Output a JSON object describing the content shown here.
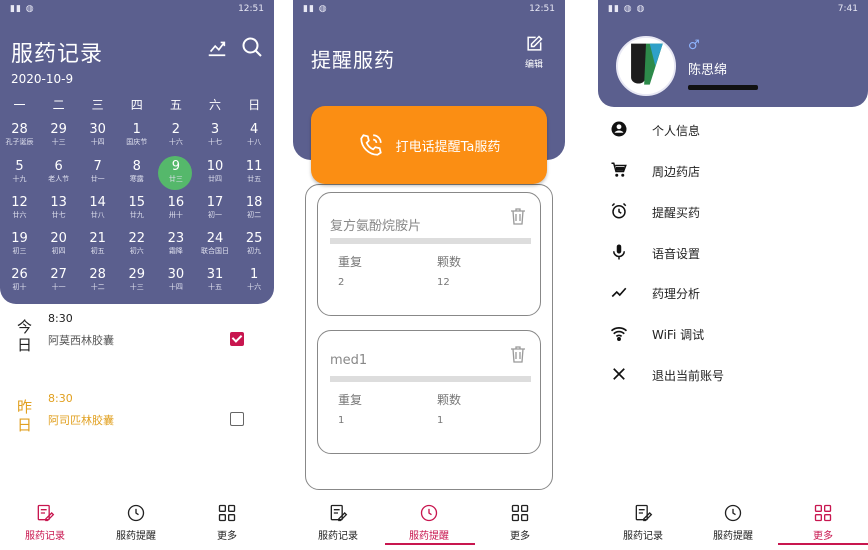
{
  "status": {
    "left": "ᵢⁱₗₗ⁴ₗₗ",
    "time1": "12:51",
    "time2": "12:51",
    "time3": "7:41"
  },
  "panel1": {
    "title": "服药记录",
    "date": "2020-10-9",
    "weekdays": [
      "一",
      "二",
      "三",
      "四",
      "五",
      "六",
      "日"
    ],
    "weeks": [
      [
        [
          "28",
          "孔子诞辰"
        ],
        [
          "29",
          "十三"
        ],
        [
          "30",
          "十四"
        ],
        [
          "1",
          "国庆节"
        ],
        [
          "2",
          "十六"
        ],
        [
          "3",
          "十七"
        ],
        [
          "4",
          "十八"
        ]
      ],
      [
        [
          "5",
          "十九"
        ],
        [
          "6",
          "老人节"
        ],
        [
          "7",
          "廿一"
        ],
        [
          "8",
          "寒露"
        ],
        [
          "9",
          "廿三"
        ],
        [
          "10",
          "廿四"
        ],
        [
          "11",
          "廿五"
        ]
      ],
      [
        [
          "12",
          "廿六"
        ],
        [
          "13",
          "廿七"
        ],
        [
          "14",
          "廿八"
        ],
        [
          "15",
          "廿九"
        ],
        [
          "16",
          "卅十"
        ],
        [
          "17",
          "初一"
        ],
        [
          "18",
          "初二"
        ]
      ],
      [
        [
          "19",
          "初三"
        ],
        [
          "20",
          "初四"
        ],
        [
          "21",
          "初五"
        ],
        [
          "22",
          "初六"
        ],
        [
          "23",
          "霜降"
        ],
        [
          "24",
          "联合国日"
        ],
        [
          "25",
          "初九"
        ]
      ],
      [
        [
          "26",
          "初十"
        ],
        [
          "27",
          "十一"
        ],
        [
          "28",
          "十二"
        ],
        [
          "29",
          "十三"
        ],
        [
          "30",
          "十四"
        ],
        [
          "31",
          "十五"
        ],
        [
          "1",
          "十六"
        ]
      ]
    ],
    "records": [
      {
        "day": "今日",
        "time": "8:30",
        "med": "阿莫西林胶囊",
        "checked": true
      },
      {
        "day": "昨日",
        "time": "8:30",
        "med": "阿司匹林胶囊",
        "checked": false
      }
    ]
  },
  "nav": {
    "records": "服药记录",
    "remind": "服药提醒",
    "more": "更多"
  },
  "panel2": {
    "title": "提醒服药",
    "edit": "编辑",
    "call": "打电话提醒Ta服药",
    "cards": [
      {
        "name": "复方氨酚烷胺片",
        "repeat_label": "重复",
        "count_label": "颗数",
        "repeat": "2",
        "count": "12"
      },
      {
        "name": "med1",
        "repeat_label": "重复",
        "count_label": "颗数",
        "repeat": "1",
        "count": "1"
      }
    ]
  },
  "panel3": {
    "gender": "♂",
    "name": "陈思绵",
    "menu": [
      "个人信息",
      "周边药店",
      "提醒买药",
      "语音设置",
      "药理分析",
      "WiFi 调试",
      "退出当前账号"
    ]
  },
  "colors": {
    "header": "#5b5f8e",
    "accent": "#c8164f",
    "call": "#fb8e13",
    "today": "#55b86b"
  }
}
